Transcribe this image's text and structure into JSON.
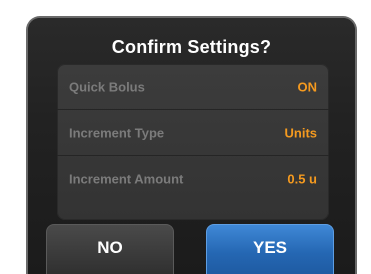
{
  "dialog": {
    "title": "Confirm Settings?"
  },
  "settings": [
    {
      "label": "Quick Bolus",
      "value": "ON"
    },
    {
      "label": "Increment Type",
      "value": "Units"
    },
    {
      "label": "Increment Amount",
      "value": "0.5 u"
    }
  ],
  "buttons": {
    "no_label": "NO",
    "yes_label": "YES"
  },
  "colors": {
    "accent_value": "#f59a1f",
    "yes_button": "#2a6fbf",
    "background": "#222222"
  }
}
